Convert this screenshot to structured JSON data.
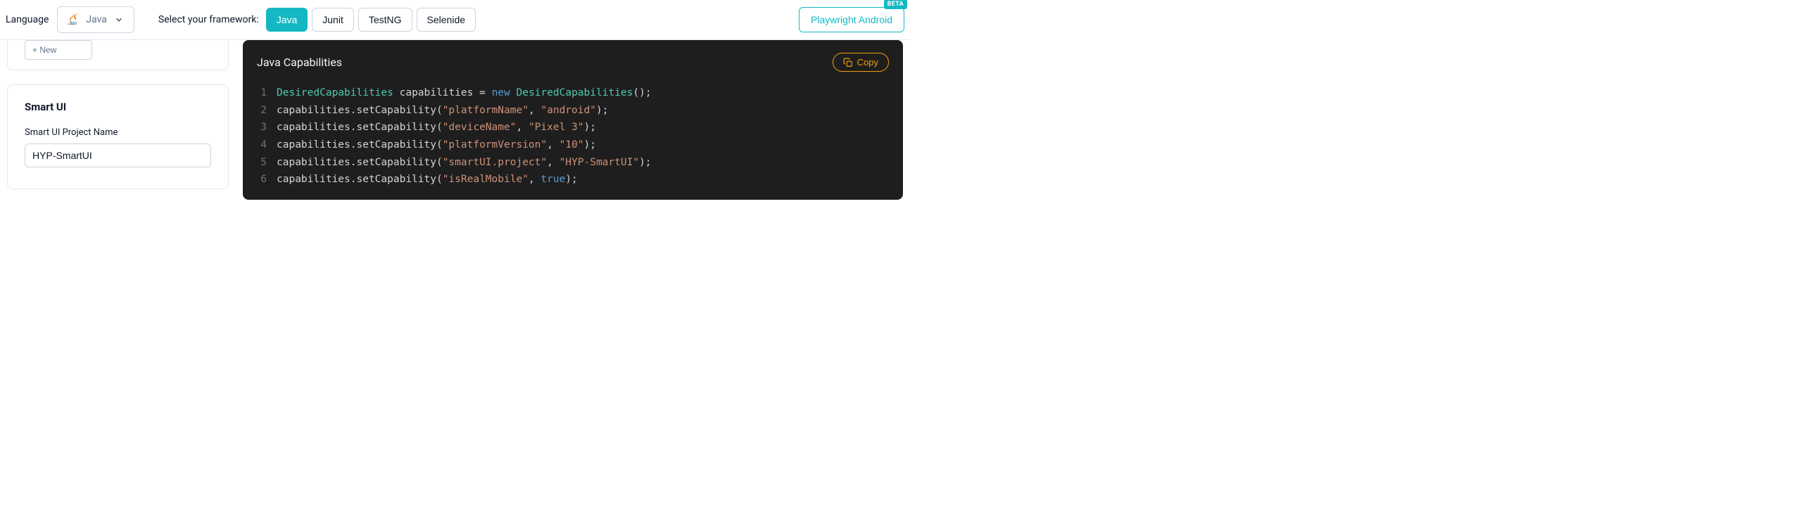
{
  "header": {
    "language_label": "Language",
    "selected_language": "Java",
    "framework_label": "Select your framework:",
    "frameworks": [
      {
        "label": "Java",
        "active": true
      },
      {
        "label": "Junit",
        "active": false
      },
      {
        "label": "TestNG",
        "active": false
      },
      {
        "label": "Selenide",
        "active": false
      }
    ],
    "playwright_btn": "Playwright Android",
    "beta_badge": "BETA"
  },
  "left": {
    "new_btn": "+ New",
    "smart_ui_title": "Smart UI",
    "project_name_label": "Smart UI Project Name",
    "project_name_value": "HYP-SmartUI"
  },
  "code": {
    "title": "Java Capabilities",
    "copy_label": "Copy",
    "lines": [
      [
        {
          "t": "type",
          "v": "DesiredCapabilities"
        },
        {
          "t": "plain",
          "v": " capabilities "
        },
        {
          "t": "punc",
          "v": "= "
        },
        {
          "t": "kw",
          "v": "new"
        },
        {
          "t": "plain",
          "v": " "
        },
        {
          "t": "type",
          "v": "DesiredCapabilities"
        },
        {
          "t": "punc",
          "v": "();"
        }
      ],
      [
        {
          "t": "plain",
          "v": "capabilities.setCapability("
        },
        {
          "t": "str",
          "v": "\"platformName\""
        },
        {
          "t": "punc",
          "v": ", "
        },
        {
          "t": "str",
          "v": "\"android\""
        },
        {
          "t": "punc",
          "v": ");"
        }
      ],
      [
        {
          "t": "plain",
          "v": "capabilities.setCapability("
        },
        {
          "t": "str",
          "v": "\"deviceName\""
        },
        {
          "t": "punc",
          "v": ", "
        },
        {
          "t": "str",
          "v": "\"Pixel 3\""
        },
        {
          "t": "punc",
          "v": ");"
        }
      ],
      [
        {
          "t": "plain",
          "v": "capabilities.setCapability("
        },
        {
          "t": "str",
          "v": "\"platformVersion\""
        },
        {
          "t": "punc",
          "v": ", "
        },
        {
          "t": "str",
          "v": "\"10\""
        },
        {
          "t": "punc",
          "v": ");"
        }
      ],
      [
        {
          "t": "plain",
          "v": "capabilities.setCapability("
        },
        {
          "t": "str",
          "v": "\"smartUI.project\""
        },
        {
          "t": "punc",
          "v": ", "
        },
        {
          "t": "str",
          "v": "\"HYP-SmartUI\""
        },
        {
          "t": "punc",
          "v": ");"
        }
      ],
      [
        {
          "t": "plain",
          "v": "capabilities.setCapability("
        },
        {
          "t": "str",
          "v": "\"isRealMobile\""
        },
        {
          "t": "punc",
          "v": ", "
        },
        {
          "t": "bool",
          "v": "true"
        },
        {
          "t": "punc",
          "v": ");"
        }
      ]
    ]
  }
}
